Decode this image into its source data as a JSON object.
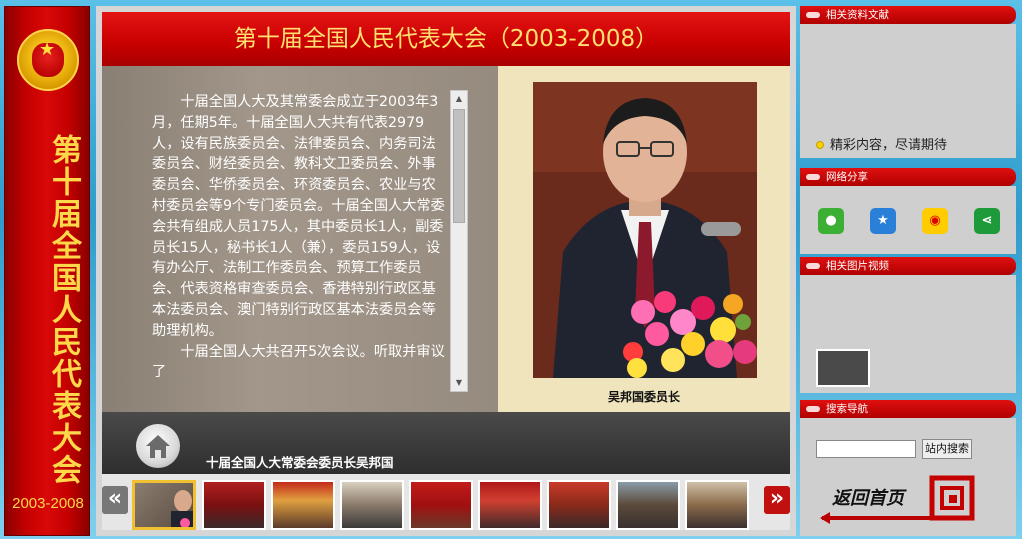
{
  "left_banner": {
    "title": "第十届全国人民代表大会",
    "years": "2003-2008"
  },
  "main": {
    "title": "第十届全国人民代表大会（2003-2008）",
    "paragraphs": [
      "十届全国人大及其常委会成立于2003年3月，任期5年。十届全国人大共有代表2979人，设有民族委员会、法律委员会、内务司法委员会、财经委员会、教科文卫委员会、外事委员会、华侨委员会、环资委员会、农业与农村委员会等9个专门委员会。十届全国人大常委会共有组成人员175人，其中委员长1人，副委员长15人，秘书长1人（兼），委员159人，设有办公厅、法制工作委员会、预算工作委员会、代表资格审查委员会、香港特别行政区基本法委员会、澳门特别行政区基本法委员会等助理机构。",
      "十届全国人大共召开5次会议。听取并审议了"
    ],
    "photo_caption": "吴邦国委员长",
    "caption_text": "十届全国人大常委会委员长吴邦国"
  },
  "thumbs": {
    "prev_icon": "«",
    "next_icon": "»",
    "count": 9,
    "active_index": 0
  },
  "right": {
    "docs": {
      "title": "相关资料文献",
      "notice": "精彩内容，尽请期待"
    },
    "share": {
      "title": "网络分享",
      "icons": [
        "wechat-icon",
        "qzone-icon",
        "weibo-icon",
        "share-icon"
      ]
    },
    "media": {
      "title": "相关图片视频"
    },
    "search": {
      "title": "搜索导航",
      "button": "站内搜索",
      "input_value": "",
      "back_home": "返回首页"
    }
  },
  "colors": {
    "banner_red": "#c40000",
    "gold": "#ffd84a",
    "title_red": "#d40000",
    "page_blue": "#3fa8d6"
  }
}
